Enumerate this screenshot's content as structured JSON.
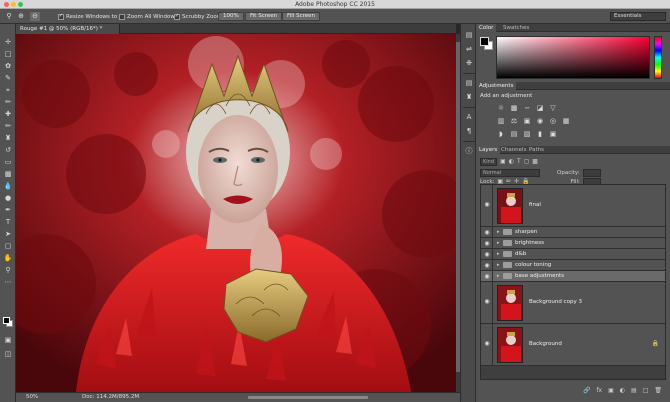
{
  "app_title": "Adobe Photoshop CC 2015",
  "options_bar": {
    "resize_windows": "Resize Windows to Fit",
    "zoom_all_windows": "Zoom All Windows",
    "scrubby_zoom": "Scrubby Zoom",
    "zoom_value": "100%",
    "fit_screen": "Fit Screen",
    "fill_screen": "Fill Screen",
    "workspace": "Essentials"
  },
  "document": {
    "tab_label": "Rouge #1 @ 50% (RGB/16*) *",
    "status_zoom": "50%",
    "status_doc": "Doc: 114.2M/895.2M"
  },
  "panels": {
    "color_tab": "Color",
    "swatches_tab": "Swatches",
    "adjustments_tab": "Adjustments",
    "add_adjustment": "Add an adjustment",
    "layers_tab": "Layers",
    "channels_tab": "Channels",
    "paths_tab": "Paths"
  },
  "layers_controls": {
    "kind": "Kind",
    "blend_mode": "Normal",
    "opacity_label": "Opacity:",
    "lock_label": "Lock:",
    "fill_label": "Fill:"
  },
  "layers": [
    {
      "name": "final",
      "kind": "image",
      "selected": false
    },
    {
      "name": "sharpen",
      "kind": "group",
      "selected": false
    },
    {
      "name": "brightness",
      "kind": "group",
      "selected": false
    },
    {
      "name": "d&b",
      "kind": "group",
      "selected": false
    },
    {
      "name": "colour toning",
      "kind": "group",
      "selected": false
    },
    {
      "name": "base adjustments",
      "kind": "group",
      "selected": true
    },
    {
      "name": "Background copy 3",
      "kind": "image",
      "selected": false
    },
    {
      "name": "Background",
      "kind": "image",
      "selected": false
    }
  ],
  "colors": {
    "ui_dark": "#282828",
    "ui_panel": "#535353",
    "photo_red": "#d4141c",
    "gold": "#c9a44c"
  }
}
